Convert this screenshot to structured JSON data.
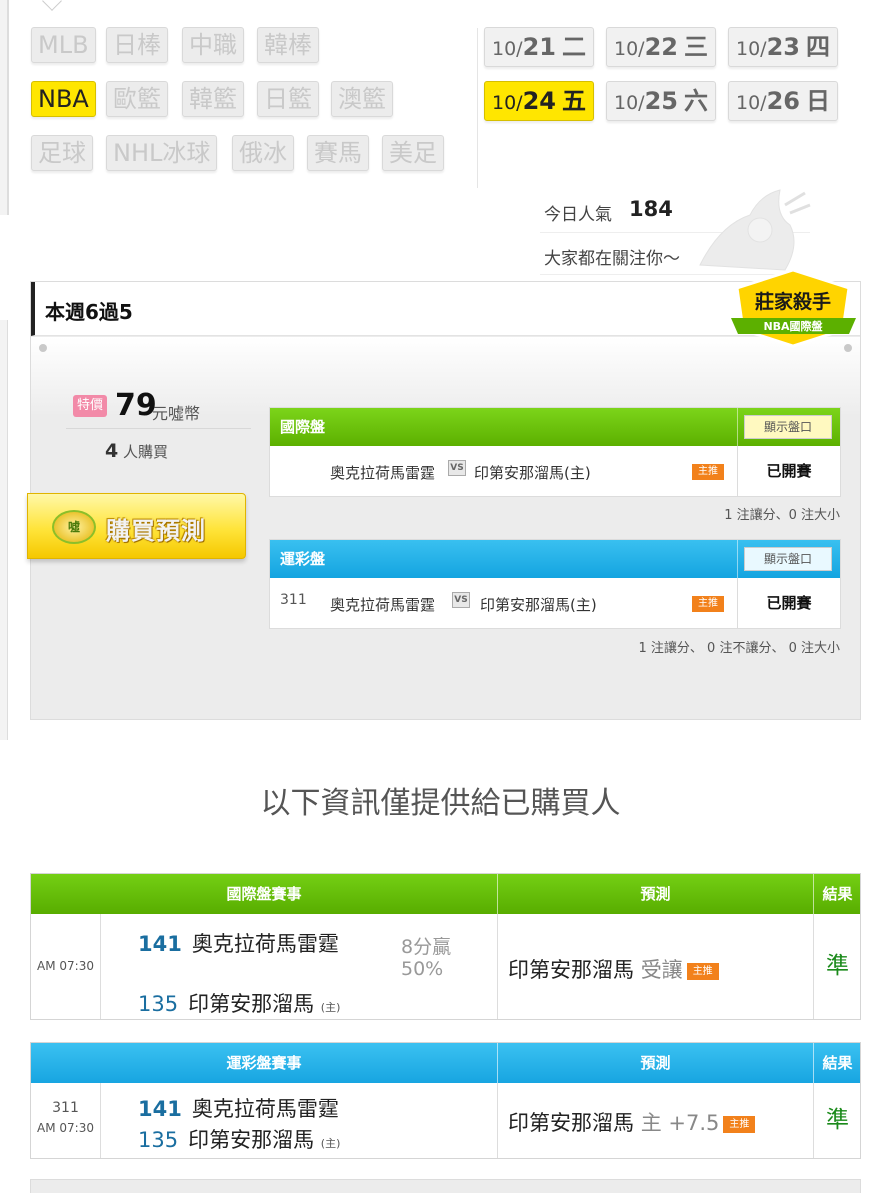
{
  "sports": {
    "row1": [
      "MLB",
      "日棒",
      "中職",
      "韓棒"
    ],
    "row2": [
      "NBA",
      "歐籃",
      "韓籃",
      "日籃",
      "澳籃"
    ],
    "row3": [
      "足球",
      "NHL冰球",
      "俄冰",
      "賽馬",
      "美足"
    ],
    "active": "NBA"
  },
  "dates": [
    {
      "month": "10/",
      "day": "21",
      "weekday": "二"
    },
    {
      "month": "10/",
      "day": "22",
      "weekday": "三"
    },
    {
      "month": "10/",
      "day": "23",
      "weekday": "四"
    },
    {
      "month": "10/",
      "day": "24",
      "weekday": "五"
    },
    {
      "month": "10/",
      "day": "25",
      "weekday": "六"
    },
    {
      "month": "10/",
      "day": "26",
      "weekday": "日"
    }
  ],
  "popularity": {
    "label": "今日人氣",
    "value": "184",
    "sub": "大家都在關注你〜"
  },
  "week": {
    "title": "本週6過5",
    "badge_main": "莊家殺手",
    "badge_sub": "NBA國際盤",
    "price_tag": "特價",
    "price": "79",
    "price_unit": "元噓幣",
    "buyer_count": "4",
    "buyer_label": "人購買",
    "buy_coin": "噓",
    "buy_label": "購買預測"
  },
  "intl": {
    "header": "國際盤",
    "show_odds": "顯示盤口",
    "num": "",
    "team_away": "奧克拉荷馬雷霆",
    "vs": "VS",
    "team_home": "印第安那溜馬(主)",
    "home_tag": "主推",
    "status": "已開賽",
    "note": "1 注讓分、0 注大小"
  },
  "sport_lottery": {
    "header": "運彩盤",
    "show_odds": "顯示盤口",
    "num": "311",
    "team_away": "奧克拉荷馬雷霆",
    "vs": "VS",
    "team_home": "印第安那溜馬(主)",
    "home_tag": "主推",
    "status": "已開賽",
    "note": "1 注讓分、 0 注不讓分、 0 注大小"
  },
  "info_heading": "以下資訊僅提供給已購買人",
  "intl_result": {
    "col_game": "國際盤賽事",
    "col_pred": "預測",
    "col_res": "結果",
    "time": "AM 07:30",
    "away_num": "141",
    "away_team": "奧克拉荷馬雷霆",
    "home_num": "135",
    "home_team": "印第安那溜馬",
    "home_mark": "(主)",
    "score_line1": "8分贏",
    "score_line2": "50%",
    "prediction": "印第安那溜馬",
    "prediction_extra": "受讓",
    "pred_tag": "主推",
    "result": "準"
  },
  "sl_result": {
    "col_game": "運彩盤賽事",
    "col_pred": "預測",
    "col_res": "結果",
    "num": "311",
    "time": "AM 07:30",
    "away_num": "141",
    "away_team": "奧克拉荷馬雷霆",
    "home_num": "135",
    "home_team": "印第安那溜馬",
    "home_mark": "(主)",
    "prediction": "印第安那溜馬",
    "prediction_extra": "主 +7.5",
    "pred_tag": "主推",
    "result": "準"
  },
  "colors": {
    "accent_yellow": "#ffe600",
    "green": "#5cb000",
    "blue": "#14a4e0",
    "win": "#1a8a1a",
    "tag_orange": "#f2811b"
  }
}
